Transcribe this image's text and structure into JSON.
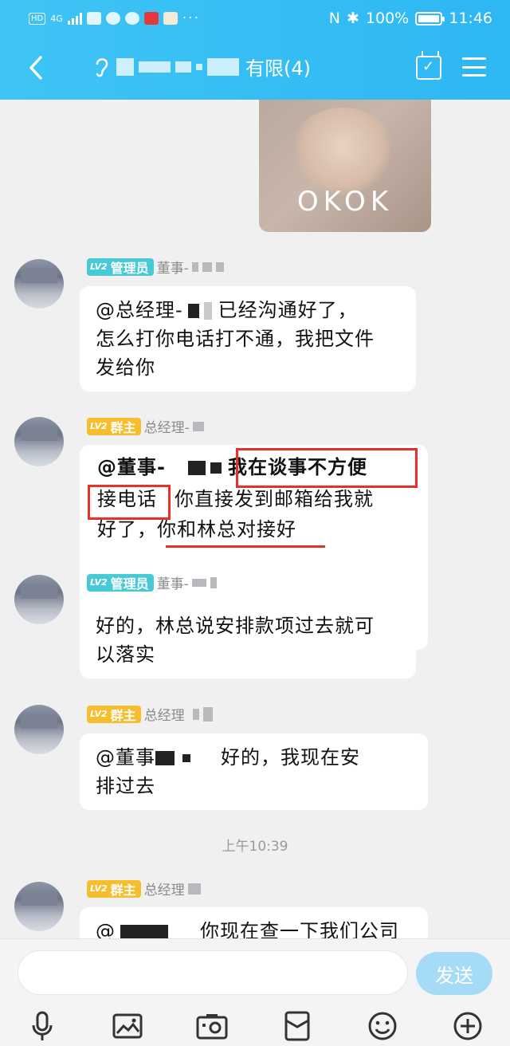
{
  "status_bar": {
    "hd": "HD",
    "network": "4G",
    "nfc": "N",
    "bluetooth": "✱",
    "battery_pct": "100%",
    "time": "11:46"
  },
  "header": {
    "back_icon": "chevron-left-icon",
    "title_suffix": "有限(4)",
    "accent_color": "#2db7f3"
  },
  "sticker": {
    "text": "OKOK"
  },
  "messages": [
    {
      "badge_level": "LV2",
      "badge_role": "管理员",
      "sender": "董事-",
      "lines": [
        "@总经理-",
        "已经沟通好了，",
        "怎么打你电话打不通，我把文件",
        "发给你"
      ]
    },
    {
      "badge_level": "LV2",
      "badge_role": "群主",
      "sender": "总经理-",
      "parts": {
        "mention": "@董事-",
        "a": "我在谈事不方便",
        "b": "接电话",
        "c": "你直接发到邮箱给我就",
        "d": "好了，",
        "e": "你和林总对接好"
      }
    },
    {
      "badge_level": "LV2",
      "badge_role": "管理员",
      "sender": "董事-",
      "lines": [
        "好的，林总说安排款项过去就可",
        "以落实"
      ]
    },
    {
      "badge_level": "LV2",
      "badge_role": "群主",
      "sender": "总经理",
      "lines": [
        "@董事",
        "好的，我现在安",
        "排过去"
      ]
    },
    {
      "badge_level": "LV2",
      "badge_role": "群主",
      "sender": "总经理",
      "lines": [
        "@",
        "你现在查一下我们公司"
      ]
    }
  ],
  "timestamp": "上午10:39",
  "input": {
    "value": "",
    "placeholder": ""
  },
  "send_label": "发送",
  "toolbar_icons": [
    "microphone-icon",
    "image-icon",
    "camera-icon",
    "red-packet-icon",
    "emoji-icon",
    "plus-icon"
  ]
}
